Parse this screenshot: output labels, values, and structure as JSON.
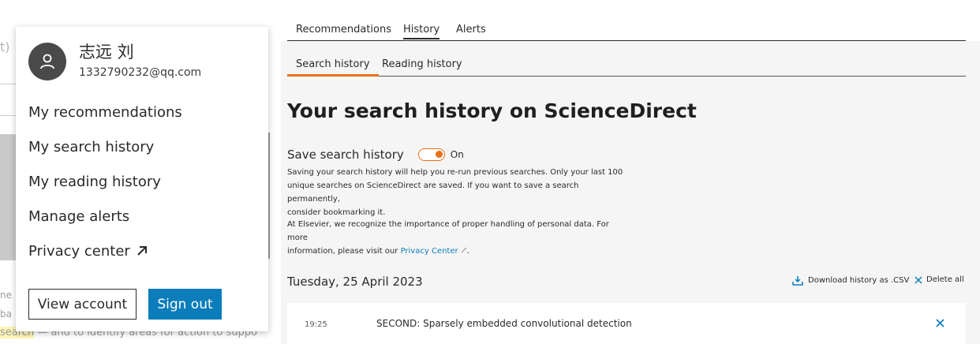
{
  "background_fragments": {
    "top": "t)",
    "line1": "ne",
    "line2": "ba",
    "line3_highlight": "search",
    "line3_rest": " — and to identify areas for action to suppo"
  },
  "account_menu": {
    "user_name": "志远 刘",
    "user_email": "1332790232@qq.com",
    "links": [
      {
        "label": "My recommendations"
      },
      {
        "label": "My search history"
      },
      {
        "label": "My reading history"
      },
      {
        "label": "Manage alerts"
      },
      {
        "label": "Privacy center"
      }
    ],
    "view_account_label": "View account",
    "sign_out_label": "Sign out"
  },
  "top_tabs": [
    {
      "label": "Recommendations",
      "active": false
    },
    {
      "label": "History",
      "active": true
    },
    {
      "label": "Alerts",
      "active": false
    }
  ],
  "sub_tabs": [
    {
      "label": "Search history",
      "active": true
    },
    {
      "label": "Reading history",
      "active": false
    }
  ],
  "page_heading": "Your search history on ScienceDirect",
  "save_history": {
    "label": "Save search history",
    "toggle_on": true,
    "state_label": "On"
  },
  "description": {
    "line1": "Saving your search history will help you re-run previous searches. Only your last 100",
    "line2": "unique searches on ScienceDirect are saved. If you want to save a search permanently,",
    "line3": "consider bookmarking it.",
    "privacy_line1": "At Elsevier, we recognize the importance of proper handling of personal data. For more",
    "privacy_line2_prefix": "information, please visit our ",
    "privacy_link": "Privacy Center",
    "privacy_line2_suffix": "."
  },
  "history_group": {
    "date": "Tuesday, 25 April 2023",
    "download_label": "Download history as .CSV",
    "delete_all_label": "Delete all",
    "entries": [
      {
        "time": "19:25",
        "query": "SECOND: Sparsely embedded convolutional detection"
      }
    ]
  },
  "colors": {
    "accent_orange": "#e9711c",
    "link_blue": "#0c7dbb",
    "sign_out_bg": "#0c7dbb"
  }
}
